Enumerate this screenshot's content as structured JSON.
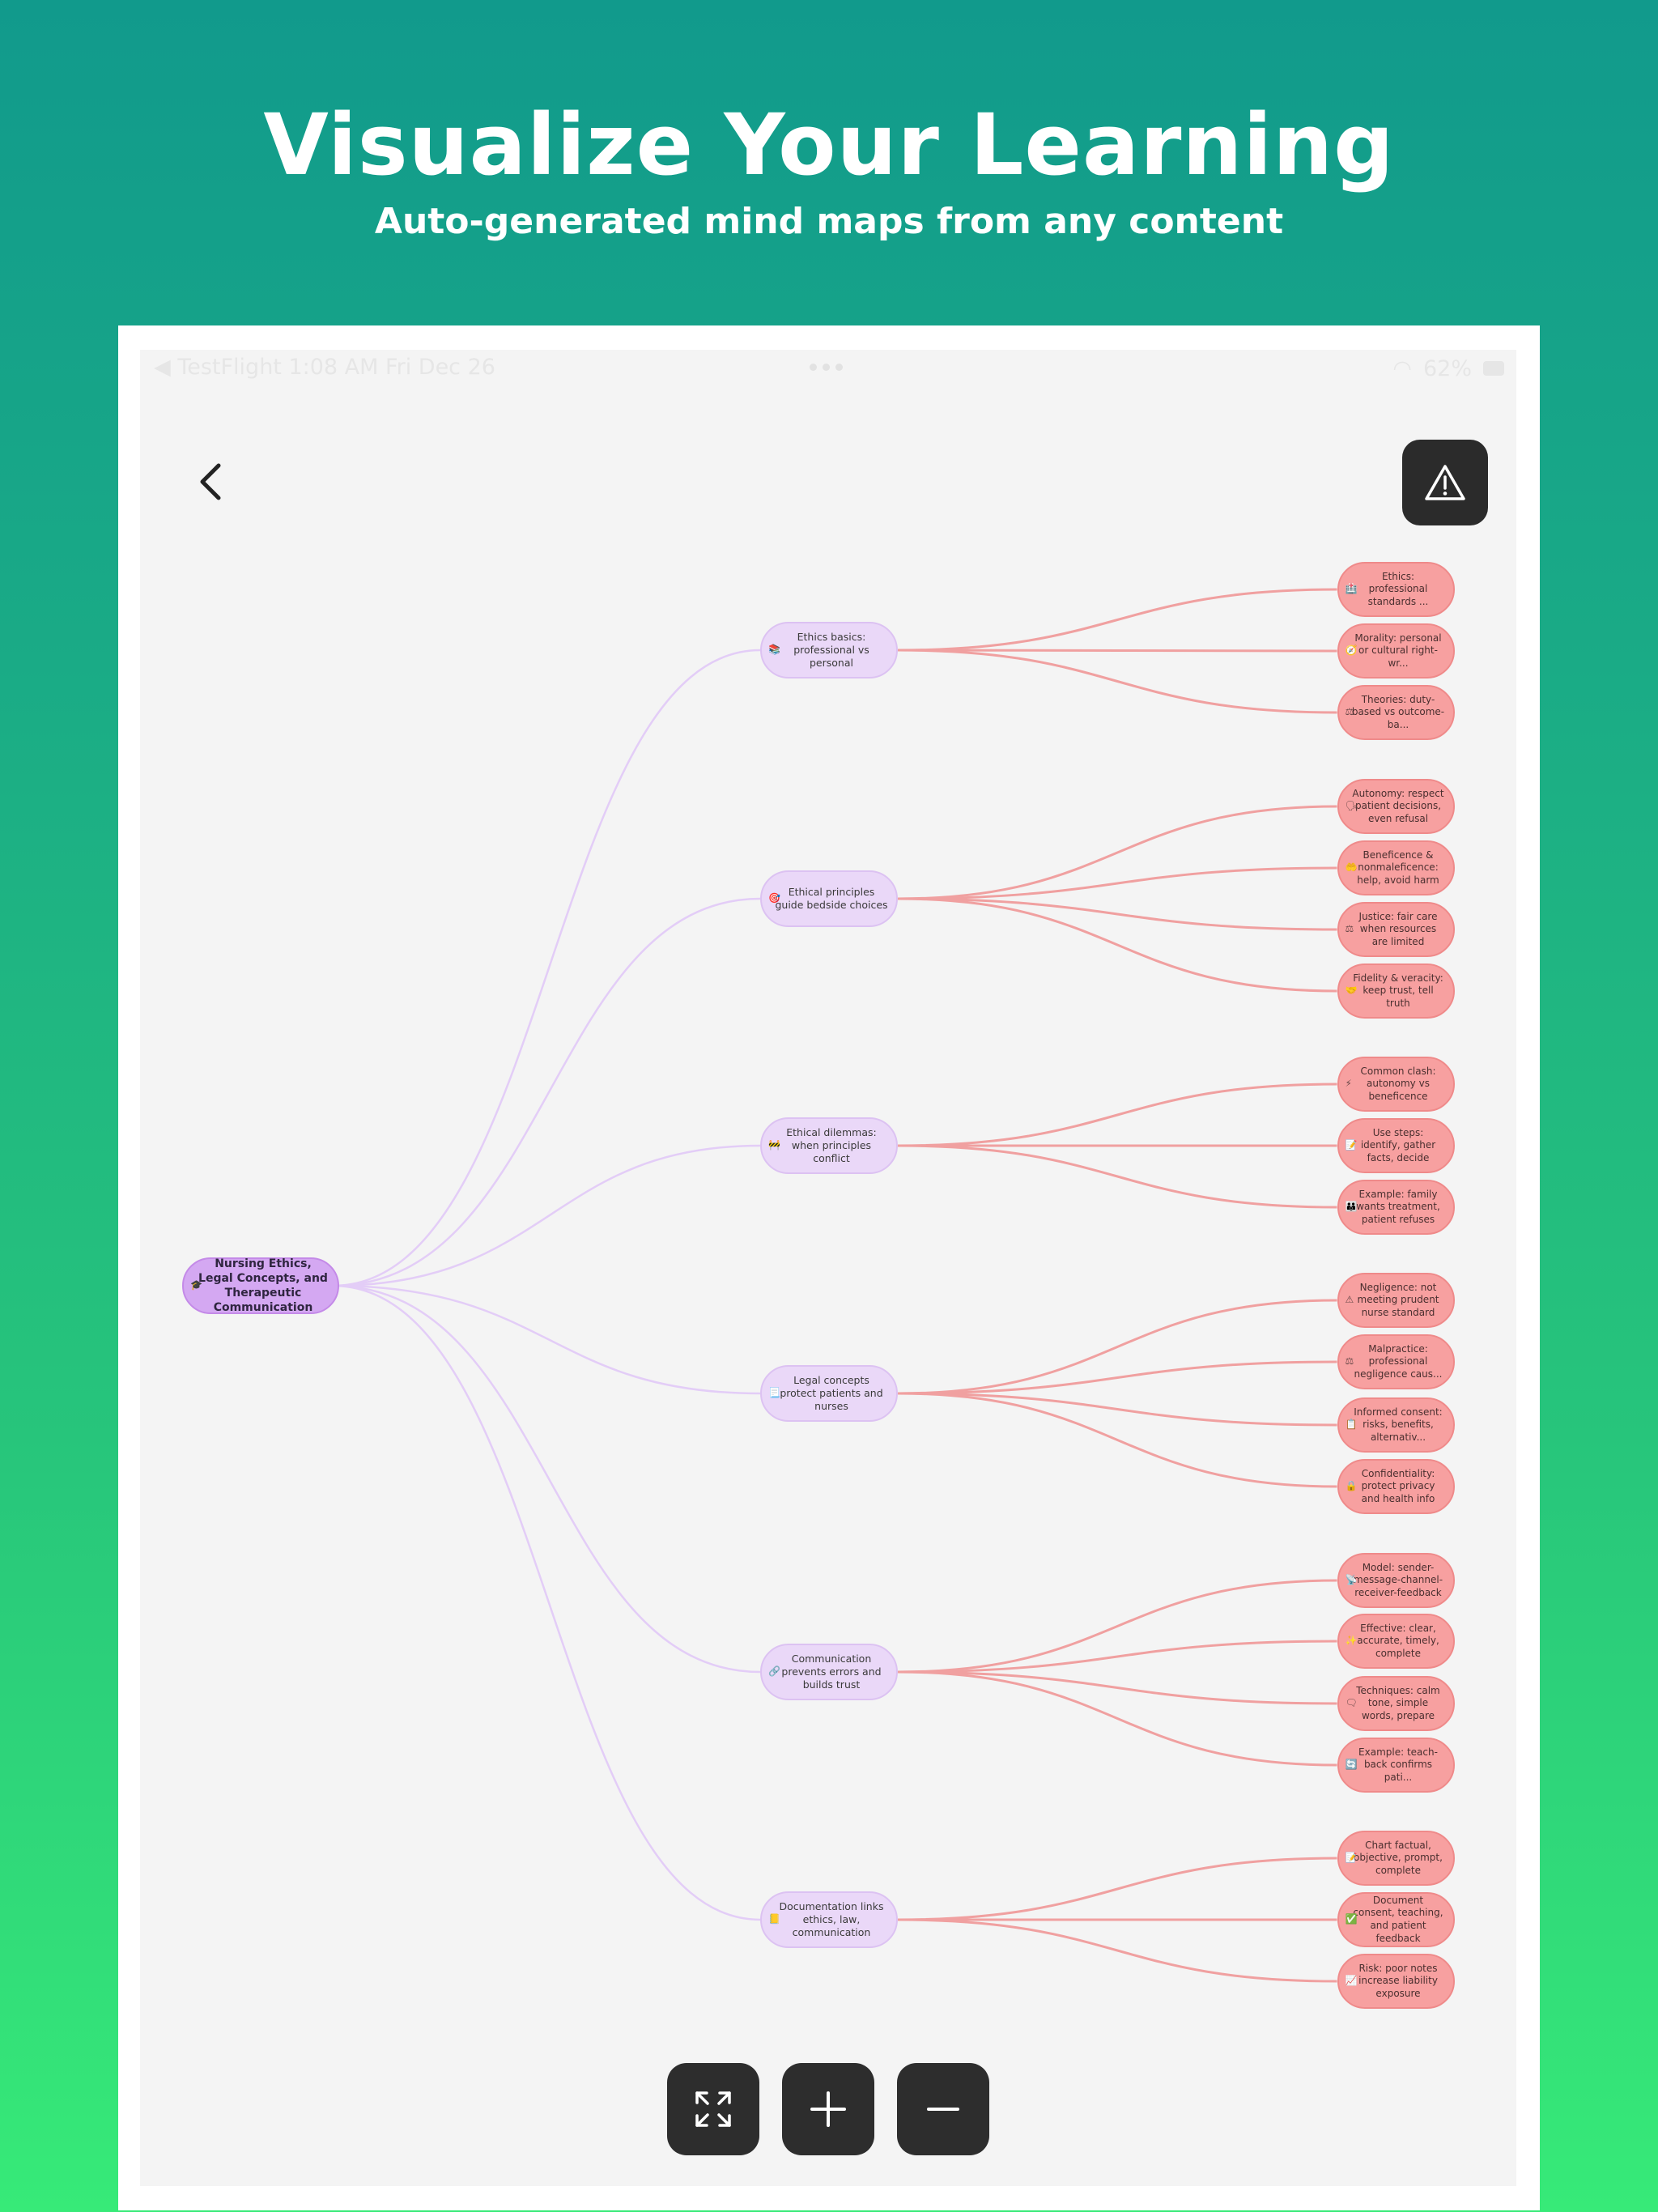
{
  "hero": {
    "title": "Visualize Your Learning",
    "subtitle": "Auto-generated mind maps from any content"
  },
  "status_bar": {
    "left": "◀ TestFlight   1:08 AM   Fri Dec 26",
    "battery": "62%"
  },
  "icons": {
    "back": "chevron-left-icon",
    "warning": "warning-triangle-icon",
    "fit": "expand-icon",
    "zoom_in": "plus-icon",
    "zoom_out": "minus-icon"
  },
  "colors": {
    "root": "#d4a8f2",
    "branch": "#ead8f8",
    "leaf": "#f7a0a0",
    "branch_link": "#e3cdf7",
    "leaf_link": "#f0a0a0"
  },
  "mindmap": {
    "root": {
      "label": "Nursing Ethics, Legal Concepts, and Therapeutic Communication",
      "emoji": "🎓"
    },
    "branches": [
      {
        "label": "Ethics basics: professional vs personal",
        "emoji": "📚",
        "leaves": [
          {
            "label": "Ethics: professional standards ...",
            "emoji": "🏥"
          },
          {
            "label": "Morality: personal or cultural right-wr...",
            "emoji": "🧭"
          },
          {
            "label": "Theories: duty-based vs outcome-ba...",
            "emoji": "⚖"
          }
        ]
      },
      {
        "label": "Ethical principles guide bedside choices",
        "emoji": "🎯",
        "leaves": [
          {
            "label": "Autonomy: respect patient decisions, even refusal",
            "emoji": "🗣"
          },
          {
            "label": "Beneficence & nonmaleficence: help, avoid harm",
            "emoji": "🤲"
          },
          {
            "label": "Justice: fair care when resources are limited",
            "emoji": "⚖"
          },
          {
            "label": "Fidelity & veracity: keep trust, tell truth",
            "emoji": "🤝"
          }
        ]
      },
      {
        "label": "Ethical dilemmas: when principles conflict",
        "emoji": "🚧",
        "leaves": [
          {
            "label": "Common clash: autonomy vs beneficence",
            "emoji": "⚡"
          },
          {
            "label": "Use steps: identify, gather facts, decide",
            "emoji": "📝"
          },
          {
            "label": "Example: family wants treatment, patient refuses",
            "emoji": "👪"
          }
        ]
      },
      {
        "label": "Legal concepts protect patients and nurses",
        "emoji": "📃",
        "leaves": [
          {
            "label": "Negligence: not meeting prudent nurse standard",
            "emoji": "⚠"
          },
          {
            "label": "Malpractice: professional negligence caus...",
            "emoji": "⚖"
          },
          {
            "label": "Informed consent: risks, benefits, alternativ...",
            "emoji": "📋"
          },
          {
            "label": "Confidentiality: protect privacy and health info",
            "emoji": "🔒"
          }
        ]
      },
      {
        "label": "Communication prevents errors and builds trust",
        "emoji": "🔗",
        "leaves": [
          {
            "label": "Model: sender-message-channel-receiver-feedback",
            "emoji": "📡"
          },
          {
            "label": "Effective: clear, accurate, timely, complete",
            "emoji": "✨"
          },
          {
            "label": "Techniques: calm tone, simple words, prepare",
            "emoji": "🗨"
          },
          {
            "label": "Example: teach-back confirms pati...",
            "emoji": "🔄"
          }
        ]
      },
      {
        "label": "Documentation links ethics, law, communication",
        "emoji": "📒",
        "leaves": [
          {
            "label": "Chart factual, objective, prompt, complete",
            "emoji": "📝"
          },
          {
            "label": "Document consent, teaching, and patient feedback",
            "emoji": "✅"
          },
          {
            "label": "Risk: poor notes increase liability exposure",
            "emoji": "📈"
          }
        ]
      }
    ]
  }
}
